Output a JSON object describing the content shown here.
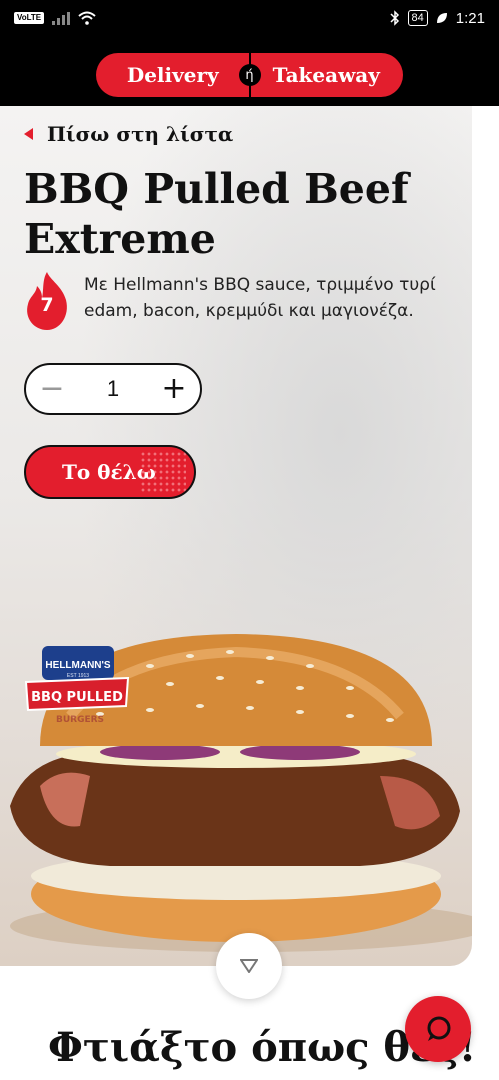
{
  "status_bar": {
    "network_badge": "VoLTE",
    "battery": "84",
    "time": "1:21"
  },
  "order_mode": {
    "delivery": "Delivery",
    "or": "ή",
    "takeaway": "Takeaway"
  },
  "product": {
    "back_label": "Πίσω στη λίστα",
    "title": "BBQ Pulled Beef Extreme",
    "spicy_level": "7",
    "description": "Με Hellmann's BBQ sauce, τριμμένο τυρί edam, bacon, κρεμμύδι και μαγιονέζα.",
    "quantity": "1",
    "add_button": "Το θέλω",
    "promo_badge": {
      "brand": "HELLMANN'S",
      "est": "EST 1913",
      "line": "BBQ PULLED",
      "sub": "BURGERS"
    }
  },
  "section_title": "Φτιάξτο όπως θες!",
  "icons": {
    "back": "triangle-left-icon",
    "spicy": "flame-icon",
    "scroll": "chevron-down-icon",
    "chat": "chat-bubble-icon"
  },
  "colors": {
    "brand_red": "#e31e2d",
    "dark": "#111111"
  }
}
